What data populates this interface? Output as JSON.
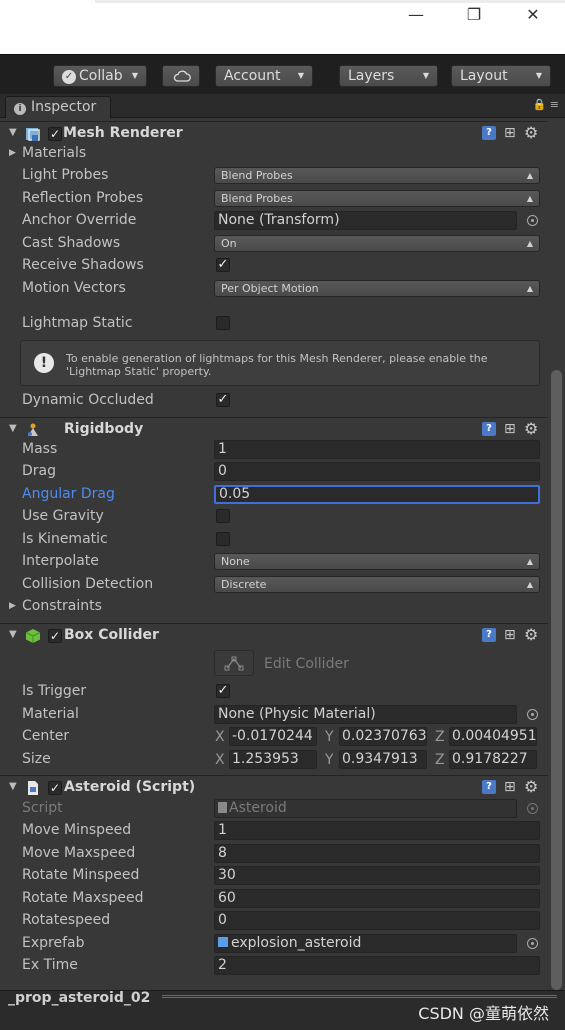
{
  "toolbar": {
    "collab": "Collab",
    "account": "Account",
    "layers": "Layers",
    "layout": "Layout"
  },
  "inspector": {
    "tab": "Inspector"
  },
  "mesh_renderer": {
    "title": "Mesh Renderer",
    "materials": "Materials",
    "light_probes_label": "Light Probes",
    "light_probes_value": "Blend Probes",
    "reflection_probes_label": "Reflection Probes",
    "reflection_probes_value": "Blend Probes",
    "anchor_override_label": "Anchor Override",
    "anchor_override_value": "None (Transform)",
    "cast_shadows_label": "Cast Shadows",
    "cast_shadows_value": "On",
    "receive_shadows_label": "Receive Shadows",
    "motion_vectors_label": "Motion Vectors",
    "motion_vectors_value": "Per Object Motion",
    "lightmap_static_label": "Lightmap Static",
    "help_message": "To enable generation of lightmaps for this Mesh Renderer, please enable the 'Lightmap Static' property.",
    "dynamic_occluded_label": "Dynamic Occluded"
  },
  "rigidbody": {
    "title": "Rigidbody",
    "mass_label": "Mass",
    "mass_value": "1",
    "drag_label": "Drag",
    "drag_value": "0",
    "angular_drag_label": "Angular Drag",
    "angular_drag_value": "0.05",
    "use_gravity_label": "Use Gravity",
    "is_kinematic_label": "Is Kinematic",
    "interpolate_label": "Interpolate",
    "interpolate_value": "None",
    "collision_detection_label": "Collision Detection",
    "collision_detection_value": "Discrete",
    "constraints": "Constraints"
  },
  "box_collider": {
    "title": "Box Collider",
    "edit_collider": "Edit Collider",
    "is_trigger_label": "Is Trigger",
    "material_label": "Material",
    "material_value": "None (Physic Material)",
    "center_label": "Center",
    "center_x": "-0.0170244",
    "center_y": "0.02370763",
    "center_z": "0.00404951",
    "size_label": "Size",
    "size_x": "1.253953",
    "size_y": "0.9347913",
    "size_z": "0.9178227",
    "axis_x": "X",
    "axis_y": "Y",
    "axis_z": "Z"
  },
  "asteroid": {
    "title": "Asteroid (Script)",
    "script_label": "Script",
    "script_value": "Asteroid",
    "move_minspeed_label": "Move Minspeed",
    "move_minspeed_value": "1",
    "move_maxspeed_label": "Move Maxspeed",
    "move_maxspeed_value": "8",
    "rotate_minspeed_label": "Rotate Minspeed",
    "rotate_minspeed_value": "30",
    "rotate_maxspeed_label": "Rotate Maxspeed",
    "rotate_maxspeed_value": "60",
    "rotatespeed_label": "Rotatespeed",
    "rotatespeed_value": "0",
    "exprefab_label": "Exprefab",
    "exprefab_value": "explosion_asteroid",
    "ex_time_label": "Ex Time",
    "ex_time_value": "2"
  },
  "footer": {
    "object_name": "_prop_asteroid_02",
    "watermark": "CSDN @童萌依然"
  }
}
